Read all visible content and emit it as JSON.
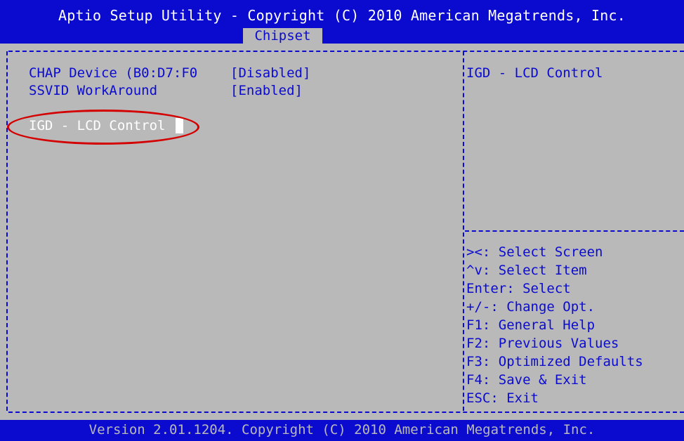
{
  "header": {
    "title": "Aptio Setup Utility - Copyright (C) 2010 American Megatrends, Inc.",
    "active_tab": "Chipset"
  },
  "settings": [
    {
      "label": "CHAP Device (B0:D7:F0",
      "value": "[Disabled]"
    },
    {
      "label": "SSVID WorkAround",
      "value": "[Enabled]"
    }
  ],
  "submenu": {
    "label": "IGD - LCD Control"
  },
  "help_panel": {
    "description": "IGD - LCD Control",
    "keys": [
      "><: Select Screen",
      "^v: Select Item",
      "Enter: Select",
      "+/-: Change Opt.",
      "F1: General Help",
      "F2: Previous Values",
      "F3: Optimized Defaults",
      "F4: Save & Exit",
      "ESC: Exit"
    ]
  },
  "footer": {
    "text": "Version 2.01.1204. Copyright (C) 2010 American Megatrends, Inc."
  },
  "colors": {
    "header_bg": "#0b0bd0",
    "body_bg": "#b9b9b9",
    "highlight": "#d40000"
  }
}
